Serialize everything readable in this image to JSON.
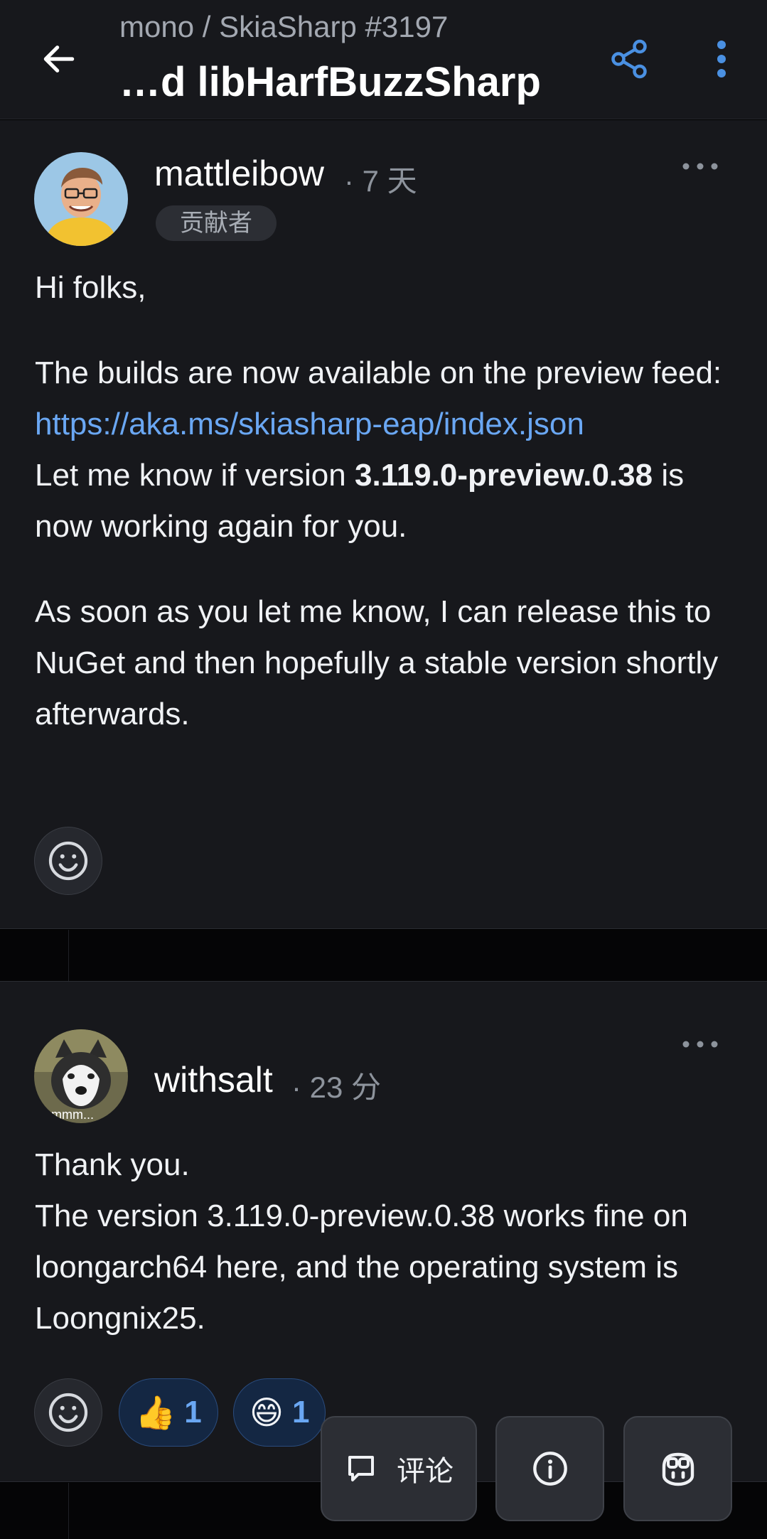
{
  "header": {
    "repo_path": "mono / SkiaSharp #3197",
    "title": "…d libHarfBuzzSharp",
    "back_icon": "arrow-left-icon",
    "share_icon": "share-icon",
    "more_icon": "more-vertical-icon"
  },
  "comments": [
    {
      "author": "mattleibow",
      "time": "· 7 天",
      "badge": "贡献者",
      "avatar_icon": "user-avatar",
      "body": {
        "greeting": "Hi folks,",
        "line1_prefix": "The builds are now available on the preview feed: ",
        "link": "https://aka.ms/skiasharp-eap/index.json",
        "line2_prefix": "Let me know if version ",
        "version": "3.119.0-preview.0.38",
        "line2_suffix": " is now working again for you.",
        "para3": "As soon as you let me know, I can release this to NuGet and then hopefully a stable version shortly afterwards."
      },
      "reactions": []
    },
    {
      "author": "withsalt",
      "time": "· 23 分",
      "avatar_caption": "emmm...",
      "body": {
        "line1": "Thank you.",
        "line2": "The version 3.119.0-preview.0.38 works fine on loongarch64 here, and the operating system is Loongnix25."
      },
      "reactions": [
        {
          "emoji": "👍",
          "count": "1"
        },
        {
          "emoji": "😄",
          "count": "1"
        }
      ]
    }
  ],
  "bottom_bar": {
    "comment_label": "评论",
    "comment_icon": "comment-icon",
    "info_icon": "info-icon",
    "copilot_icon": "copilot-icon"
  },
  "colors": {
    "background": "#17181c",
    "link": "#6aa7f3",
    "accent_blue": "#4a90e2"
  }
}
